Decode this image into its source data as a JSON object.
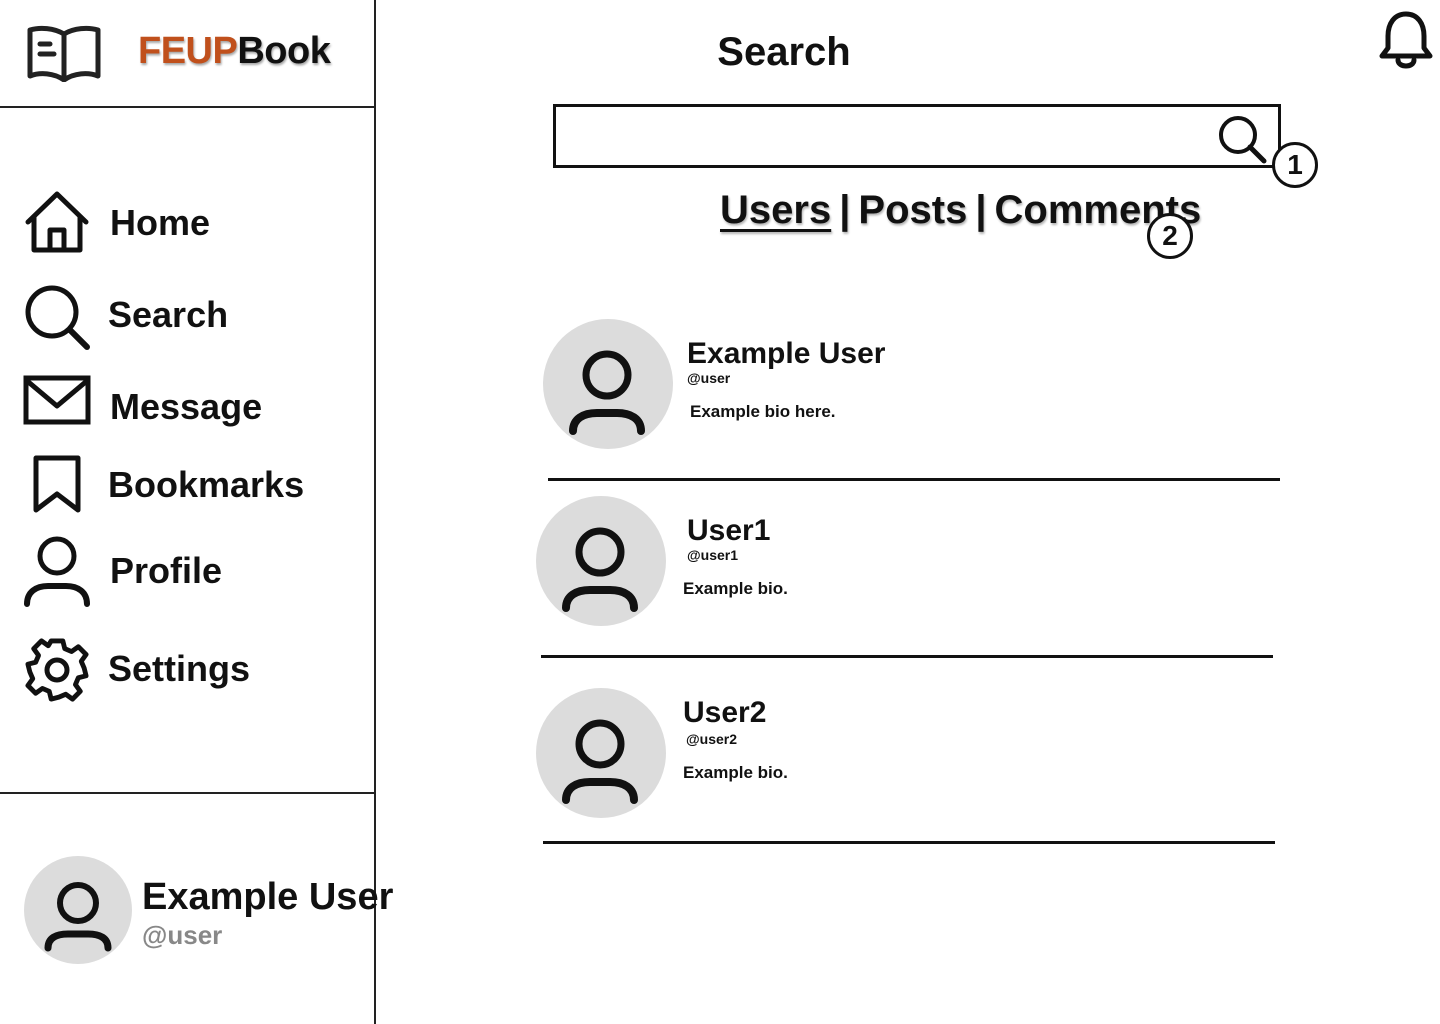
{
  "brand": {
    "accent": "FEUP",
    "rest": "Book",
    "accent_color": "#c0501c",
    "icon": "book-open-icon"
  },
  "sidebar": {
    "items": [
      {
        "label": "Home",
        "icon": "home-icon"
      },
      {
        "label": "Search",
        "icon": "search-icon"
      },
      {
        "label": "Message",
        "icon": "mail-icon"
      },
      {
        "label": "Bookmarks",
        "icon": "bookmark-icon"
      },
      {
        "label": "Profile",
        "icon": "user-icon"
      },
      {
        "label": "Settings",
        "icon": "gear-icon"
      }
    ],
    "current_user": {
      "name": "Example User",
      "handle": "@user"
    }
  },
  "header": {
    "title": "Search",
    "notifications_icon": "bell-icon"
  },
  "search": {
    "value": "",
    "placeholder": "",
    "icon": "search-icon"
  },
  "annotations": {
    "marker_1": "1",
    "marker_2": "2"
  },
  "tabs": [
    {
      "label": "Users",
      "active": true
    },
    {
      "label": "Posts",
      "active": false
    },
    {
      "label": "Comments",
      "active": false
    }
  ],
  "tab_separator": "|",
  "results": [
    {
      "name": "Example User",
      "handle": "@user",
      "bio": "Example bio here."
    },
    {
      "name": "User1",
      "handle": "@user1",
      "bio": "Example bio."
    },
    {
      "name": "User2",
      "handle": "@user2",
      "bio": "Example bio."
    }
  ],
  "colors": {
    "avatar_bg": "#dcdcdc",
    "muted": "#888888",
    "ink": "#111111"
  }
}
